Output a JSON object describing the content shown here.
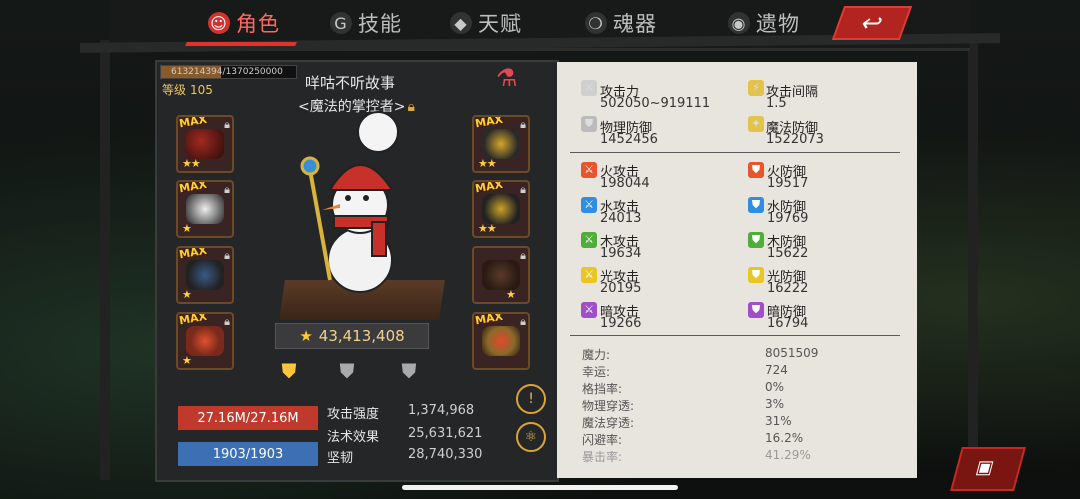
{
  "tabs": [
    {
      "label": "角色",
      "icon": "character-icon",
      "active": true
    },
    {
      "label": "技能",
      "icon": "skill-icon",
      "active": false
    },
    {
      "label": "天赋",
      "icon": "talent-icon",
      "active": false
    },
    {
      "label": "魂器",
      "icon": "soul-vessel-icon",
      "active": false
    },
    {
      "label": "遗物",
      "icon": "relic-icon",
      "active": false
    }
  ],
  "character": {
    "exp_text": "613214394/1370250000",
    "exp_progress": 0.4476,
    "level_label": "等级",
    "level": "105",
    "name": "咩咕不听故事",
    "title": "<魔法的掌控者>",
    "power": "43,413,408"
  },
  "equipment": {
    "max_label": "MAX",
    "left": [
      {
        "stars": "★★"
      },
      {
        "stars": "★"
      },
      {
        "stars": "★"
      },
      {
        "stars": "★"
      }
    ],
    "right": [
      {
        "stars": "★★"
      },
      {
        "stars": "★★"
      },
      {
        "stars": "★"
      },
      {
        "stars": ""
      }
    ]
  },
  "bars": {
    "hp": "27.16M/27.16M",
    "mp": "1903/1903"
  },
  "sub_stats": [
    {
      "label": "攻击强度",
      "value": "1,374,968"
    },
    {
      "label": "法术效果",
      "value": "25,631,621"
    },
    {
      "label": "坚韧",
      "value": "28,740,330"
    }
  ],
  "core_stats": [
    {
      "label": "攻击力",
      "value": "502050~919111"
    },
    {
      "label": "攻击间隔",
      "value": "1.5"
    },
    {
      "label": "物理防御",
      "value": "1452456"
    },
    {
      "label": "魔法防御",
      "value": "1522073"
    }
  ],
  "element_stats": [
    {
      "label": "火攻击",
      "value": "198044",
      "color": "#e8542c"
    },
    {
      "label": "火防御",
      "value": "19517",
      "color": "#e8542c"
    },
    {
      "label": "水攻击",
      "value": "24013",
      "color": "#2f8ee0"
    },
    {
      "label": "水防御",
      "value": "19769",
      "color": "#2f8ee0"
    },
    {
      "label": "木攻击",
      "value": "19634",
      "color": "#4fae3a"
    },
    {
      "label": "木防御",
      "value": "15622",
      "color": "#4fae3a"
    },
    {
      "label": "光攻击",
      "value": "20195",
      "color": "#e9c623"
    },
    {
      "label": "光防御",
      "value": "16222",
      "color": "#e9c623"
    },
    {
      "label": "暗攻击",
      "value": "19266",
      "color": "#a04fc8"
    },
    {
      "label": "暗防御",
      "value": "16794",
      "color": "#a04fc8"
    }
  ],
  "misc_stats": [
    {
      "label": "魔力:",
      "value": "8051509"
    },
    {
      "label": "幸运:",
      "value": "724"
    },
    {
      "label": "格挡率:",
      "value": "0%"
    },
    {
      "label": "物理穿透:",
      "value": "3%"
    },
    {
      "label": "魔法穿透:",
      "value": "31%"
    },
    {
      "label": "闪避率:",
      "value": "16.2%"
    },
    {
      "label": "暴击率:",
      "value": "41.29%"
    }
  ]
}
